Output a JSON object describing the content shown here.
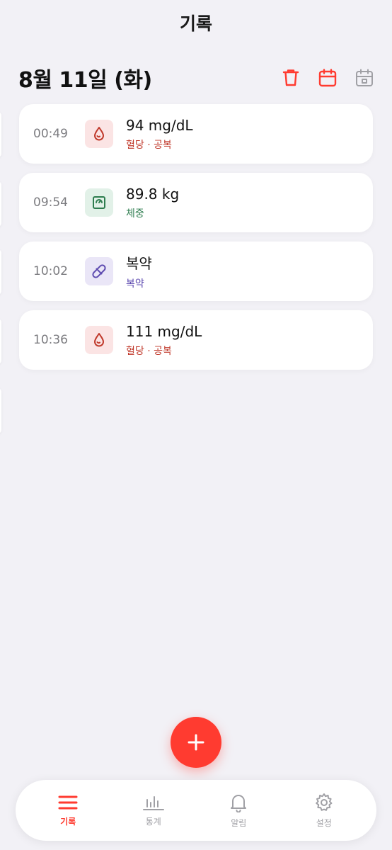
{
  "header": {
    "title": "기록"
  },
  "date_bar": {
    "date": "8월 11일 (화)",
    "actions": [
      {
        "icon": "trash-icon",
        "color": "#ff3b30"
      },
      {
        "icon": "calendar-icon",
        "color": "#ff3b30"
      },
      {
        "icon": "calendar-day-icon",
        "color": "#a0a0a5"
      }
    ]
  },
  "records": [
    {
      "time": "00:49",
      "value": "94 mg/dL",
      "category": "혈당 · 공복",
      "icon": "blood-drop-icon",
      "accent": "#c0392b",
      "bg": "#fbe4e4"
    },
    {
      "time": "09:54",
      "value": "89.8 kg",
      "category": "체중",
      "icon": "scale-icon",
      "accent": "#2e7d4f",
      "bg": "#e2f1e8"
    },
    {
      "time": "10:02",
      "value": "복약",
      "category": "복약",
      "icon": "pill-icon",
      "accent": "#5e4bb0",
      "bg": "#eae6f7"
    },
    {
      "time": "10:36",
      "value": "111 mg/dL",
      "category": "혈당 · 공복",
      "icon": "blood-drop-icon",
      "accent": "#c0392b",
      "bg": "#fbe4e4"
    }
  ],
  "fab": {
    "icon": "plus-icon",
    "color": "#ff3b30"
  },
  "tabbar": {
    "tabs": [
      {
        "label": "기록",
        "icon": "list-icon",
        "active": true
      },
      {
        "label": "통계",
        "icon": "bar-chart-icon",
        "active": false
      },
      {
        "label": "알림",
        "icon": "bell-icon",
        "active": false
      },
      {
        "label": "설정",
        "icon": "gear-icon",
        "active": false
      }
    ]
  },
  "colors": {
    "accent": "#ff3b30",
    "background": "#f2f1f6",
    "inactive": "#a0a0a5"
  }
}
